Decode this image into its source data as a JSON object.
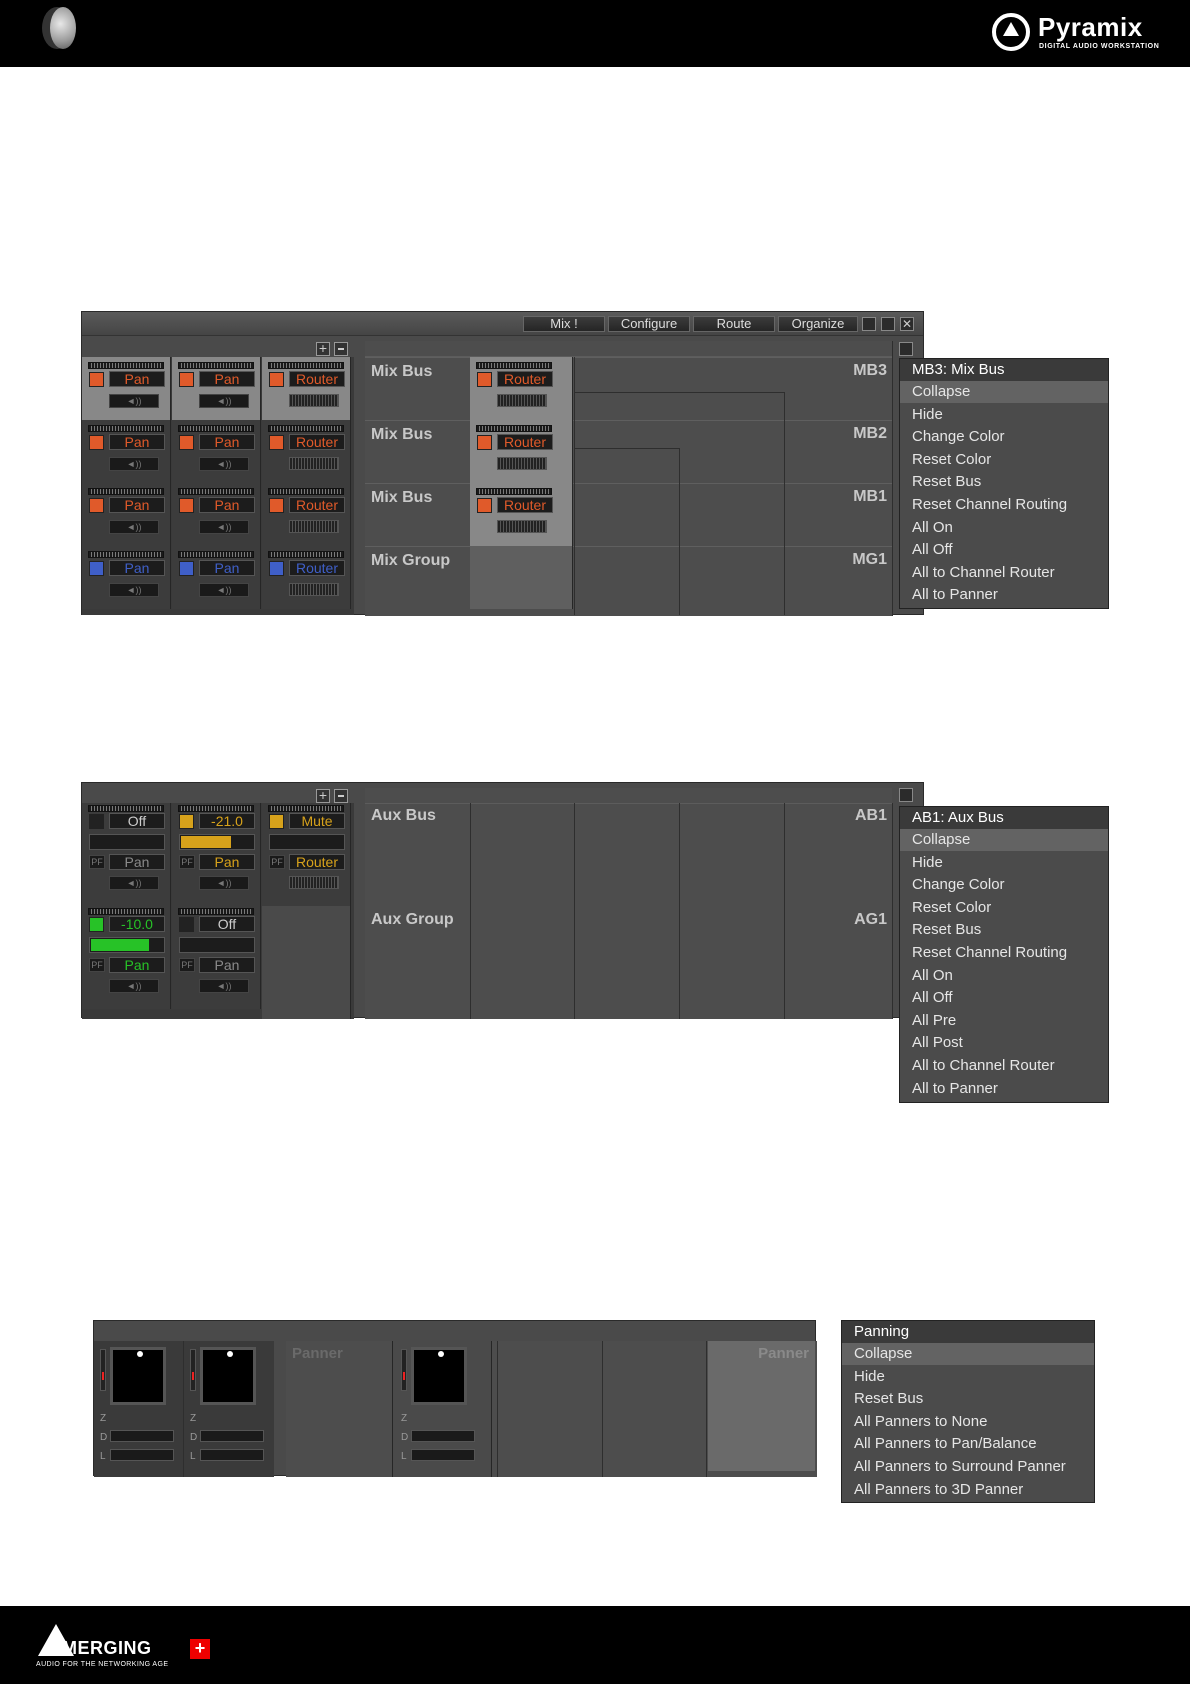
{
  "header": {
    "brand_name": "Pyramix",
    "brand_sub": "DIGITAL AUDIO WORKSTATION"
  },
  "footer": {
    "brand_name": "MERGING",
    "brand_sub": "AUDIO FOR THE NETWORKING AGE"
  },
  "panel1": {
    "tabs": [
      "Mix !",
      "Configure",
      "Route",
      "Organize"
    ],
    "strip_labels": [
      "Pan",
      "Pan",
      "Router"
    ],
    "buses": [
      {
        "name": "Mix Bus",
        "id": "MB3",
        "router": "Router"
      },
      {
        "name": "Mix Bus",
        "id": "MB2",
        "router": "Router"
      },
      {
        "name": "Mix Bus",
        "id": "MB1",
        "router": "Router"
      },
      {
        "name": "Mix Group",
        "id": "MG1",
        "router": ""
      }
    ],
    "menu": {
      "title": "MB3: Mix Bus",
      "items": [
        "Collapse",
        "Hide",
        "Change Color",
        "Reset Color",
        "Reset Bus",
        "Reset Channel Routing",
        "All On",
        "All Off",
        "All to Channel Router",
        "All to Panner"
      ]
    }
  },
  "panel2": {
    "row1": {
      "values": [
        "Off",
        "-21.0",
        "Mute"
      ],
      "labels": [
        "Pan",
        "Pan",
        "Router"
      ]
    },
    "row2": {
      "values": [
        "-10.0",
        "Off"
      ],
      "labels": [
        "Pan",
        "Pan"
      ]
    },
    "pf": "PF",
    "buses": [
      {
        "name": "Aux Bus",
        "id": "AB1"
      },
      {
        "name": "Aux Group",
        "id": "AG1"
      }
    ],
    "menu": {
      "title": "AB1: Aux Bus",
      "items": [
        "Collapse",
        "Hide",
        "Change Color",
        "Reset Color",
        "Reset Bus",
        "Reset Channel Routing",
        "All On",
        "All Off",
        "All Pre",
        "All Post",
        "All to Channel Router",
        "All to Panner"
      ]
    }
  },
  "panel3": {
    "panner_label": "Panner",
    "panner_label_right": "Panner",
    "field_labels": [
      "Z",
      "D",
      "L"
    ],
    "menu": {
      "title": "Panning",
      "items": [
        "Collapse",
        "Hide",
        "Reset Bus",
        "All Panners to None",
        "All Panners to Pan/Balance",
        "All Panners to Surround Panner",
        "All Panners to 3D Panner"
      ]
    }
  },
  "colors": {
    "orange": "#e05a2a",
    "blue": "#3f5fc8",
    "yellow": "#d7a21b",
    "green": "#27c227"
  }
}
